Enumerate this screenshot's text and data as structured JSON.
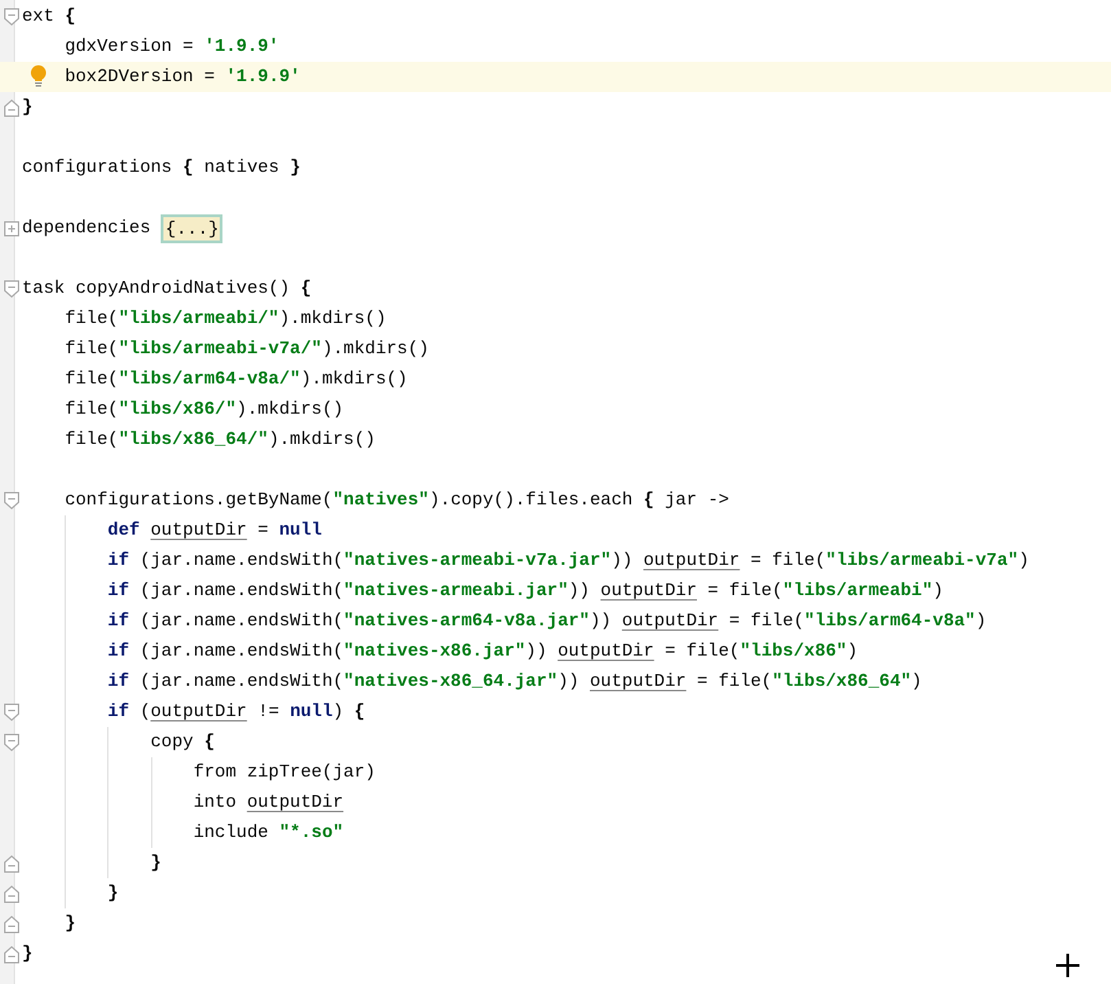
{
  "editor": {
    "lines": [
      {
        "kind": "code",
        "fold": {
          "kind": "start"
        },
        "highlighted": false,
        "bulb": false,
        "tokens": [
          {
            "kind": "plain",
            "text": "ext "
          },
          {
            "kind": "brace",
            "text": "{"
          }
        ]
      },
      {
        "kind": "code",
        "highlighted": false,
        "bulb": false,
        "tokens": [
          {
            "kind": "plain",
            "text": "    gdxVersion = "
          },
          {
            "kind": "string",
            "text": "'1.9.9'"
          }
        ]
      },
      {
        "kind": "code",
        "highlighted": true,
        "bulb": true,
        "tokens": [
          {
            "kind": "plain",
            "text": "    box2DVersion = "
          },
          {
            "kind": "string",
            "text": "'1.9.9'"
          }
        ]
      },
      {
        "kind": "code",
        "fold": {
          "kind": "end"
        },
        "highlighted": false,
        "bulb": false,
        "tokens": [
          {
            "kind": "brace",
            "text": "}"
          }
        ]
      },
      {
        "kind": "blank",
        "highlighted": false,
        "bulb": false
      },
      {
        "kind": "code",
        "highlighted": false,
        "bulb": false,
        "tokens": [
          {
            "kind": "plain",
            "text": "configurations "
          },
          {
            "kind": "brace",
            "text": "{"
          },
          {
            "kind": "plain",
            "text": " natives "
          },
          {
            "kind": "brace",
            "text": "}"
          }
        ]
      },
      {
        "kind": "blank",
        "highlighted": false,
        "bulb": false
      },
      {
        "kind": "code",
        "fold": {
          "kind": "collapsed"
        },
        "highlighted": false,
        "bulb": false,
        "tokens": [
          {
            "kind": "plain",
            "text": "dependencies "
          },
          {
            "kind": "folded",
            "text": "{...}"
          }
        ]
      },
      {
        "kind": "blank",
        "highlighted": false,
        "bulb": false
      },
      {
        "kind": "code",
        "fold": {
          "kind": "start"
        },
        "highlighted": false,
        "bulb": false,
        "tokens": [
          {
            "kind": "plain",
            "text": "task copyAndroidNatives() "
          },
          {
            "kind": "brace",
            "text": "{"
          }
        ]
      },
      {
        "kind": "code",
        "highlighted": false,
        "bulb": false,
        "tokens": [
          {
            "kind": "plain",
            "text": "    file("
          },
          {
            "kind": "string",
            "text": "\"libs/armeabi/\""
          },
          {
            "kind": "plain",
            "text": ").mkdirs()"
          }
        ]
      },
      {
        "kind": "code",
        "highlighted": false,
        "bulb": false,
        "tokens": [
          {
            "kind": "plain",
            "text": "    file("
          },
          {
            "kind": "string",
            "text": "\"libs/armeabi-v7a/\""
          },
          {
            "kind": "plain",
            "text": ").mkdirs()"
          }
        ]
      },
      {
        "kind": "code",
        "highlighted": false,
        "bulb": false,
        "tokens": [
          {
            "kind": "plain",
            "text": "    file("
          },
          {
            "kind": "string",
            "text": "\"libs/arm64-v8a/\""
          },
          {
            "kind": "plain",
            "text": ").mkdirs()"
          }
        ]
      },
      {
        "kind": "code",
        "highlighted": false,
        "bulb": false,
        "tokens": [
          {
            "kind": "plain",
            "text": "    file("
          },
          {
            "kind": "string",
            "text": "\"libs/x86/\""
          },
          {
            "kind": "plain",
            "text": ").mkdirs()"
          }
        ]
      },
      {
        "kind": "code",
        "highlighted": false,
        "bulb": false,
        "tokens": [
          {
            "kind": "plain",
            "text": "    file("
          },
          {
            "kind": "string",
            "text": "\"libs/x86_64/\""
          },
          {
            "kind": "plain",
            "text": ").mkdirs()"
          }
        ]
      },
      {
        "kind": "blank",
        "highlighted": false,
        "bulb": false
      },
      {
        "kind": "code",
        "fold": {
          "kind": "start"
        },
        "highlighted": false,
        "bulb": false,
        "tokens": [
          {
            "kind": "plain",
            "text": "    configurations.getByName("
          },
          {
            "kind": "string",
            "text": "\"natives\""
          },
          {
            "kind": "plain",
            "text": ").copy().files.each "
          },
          {
            "kind": "brace",
            "text": "{"
          },
          {
            "kind": "plain",
            "text": " jar ->"
          }
        ]
      },
      {
        "kind": "code",
        "highlighted": false,
        "bulb": false,
        "tokens": [
          {
            "kind": "keyword",
            "text": "        def "
          },
          {
            "kind": "field",
            "text": "outputDir"
          },
          {
            "kind": "plain",
            "text": " = "
          },
          {
            "kind": "keyword",
            "text": "null"
          }
        ]
      },
      {
        "kind": "code",
        "highlighted": false,
        "bulb": false,
        "tokens": [
          {
            "kind": "keyword",
            "text": "        if"
          },
          {
            "kind": "plain",
            "text": " (jar.name.endsWith("
          },
          {
            "kind": "string",
            "text": "\"natives-armeabi-v7a.jar\""
          },
          {
            "kind": "plain",
            "text": ")) "
          },
          {
            "kind": "field",
            "text": "outputDir"
          },
          {
            "kind": "plain",
            "text": " = file("
          },
          {
            "kind": "string",
            "text": "\"libs/armeabi-v7a\""
          },
          {
            "kind": "plain",
            "text": ")"
          }
        ]
      },
      {
        "kind": "code",
        "highlighted": false,
        "bulb": false,
        "tokens": [
          {
            "kind": "keyword",
            "text": "        if"
          },
          {
            "kind": "plain",
            "text": " (jar.name.endsWith("
          },
          {
            "kind": "string",
            "text": "\"natives-armeabi.jar\""
          },
          {
            "kind": "plain",
            "text": ")) "
          },
          {
            "kind": "field",
            "text": "outputDir"
          },
          {
            "kind": "plain",
            "text": " = file("
          },
          {
            "kind": "string",
            "text": "\"libs/armeabi\""
          },
          {
            "kind": "plain",
            "text": ")"
          }
        ]
      },
      {
        "kind": "code",
        "highlighted": false,
        "bulb": false,
        "tokens": [
          {
            "kind": "keyword",
            "text": "        if"
          },
          {
            "kind": "plain",
            "text": " (jar.name.endsWith("
          },
          {
            "kind": "string",
            "text": "\"natives-arm64-v8a.jar\""
          },
          {
            "kind": "plain",
            "text": ")) "
          },
          {
            "kind": "field",
            "text": "outputDir"
          },
          {
            "kind": "plain",
            "text": " = file("
          },
          {
            "kind": "string",
            "text": "\"libs/arm64-v8a\""
          },
          {
            "kind": "plain",
            "text": ")"
          }
        ]
      },
      {
        "kind": "code",
        "highlighted": false,
        "bulb": false,
        "tokens": [
          {
            "kind": "keyword",
            "text": "        if"
          },
          {
            "kind": "plain",
            "text": " (jar.name.endsWith("
          },
          {
            "kind": "string",
            "text": "\"natives-x86.jar\""
          },
          {
            "kind": "plain",
            "text": ")) "
          },
          {
            "kind": "field",
            "text": "outputDir"
          },
          {
            "kind": "plain",
            "text": " = file("
          },
          {
            "kind": "string",
            "text": "\"libs/x86\""
          },
          {
            "kind": "plain",
            "text": ")"
          }
        ]
      },
      {
        "kind": "code",
        "highlighted": false,
        "bulb": false,
        "tokens": [
          {
            "kind": "keyword",
            "text": "        if"
          },
          {
            "kind": "plain",
            "text": " (jar.name.endsWith("
          },
          {
            "kind": "string",
            "text": "\"natives-x86_64.jar\""
          },
          {
            "kind": "plain",
            "text": ")) "
          },
          {
            "kind": "field",
            "text": "outputDir"
          },
          {
            "kind": "plain",
            "text": " = file("
          },
          {
            "kind": "string",
            "text": "\"libs/x86_64\""
          },
          {
            "kind": "plain",
            "text": ")"
          }
        ]
      },
      {
        "kind": "code",
        "fold": {
          "kind": "start"
        },
        "highlighted": false,
        "bulb": false,
        "tokens": [
          {
            "kind": "keyword",
            "text": "        if"
          },
          {
            "kind": "plain",
            "text": " ("
          },
          {
            "kind": "field",
            "text": "outputDir"
          },
          {
            "kind": "plain",
            "text": " != "
          },
          {
            "kind": "keyword",
            "text": "null"
          },
          {
            "kind": "plain",
            "text": ") "
          },
          {
            "kind": "brace",
            "text": "{"
          }
        ]
      },
      {
        "kind": "code",
        "fold": {
          "kind": "start"
        },
        "highlighted": false,
        "bulb": false,
        "tokens": [
          {
            "kind": "plain",
            "text": "            copy "
          },
          {
            "kind": "brace",
            "text": "{"
          }
        ]
      },
      {
        "kind": "code",
        "highlighted": false,
        "bulb": false,
        "tokens": [
          {
            "kind": "plain",
            "text": "                from zipTree(jar)"
          }
        ]
      },
      {
        "kind": "code",
        "highlighted": false,
        "bulb": false,
        "tokens": [
          {
            "kind": "plain",
            "text": "                into "
          },
          {
            "kind": "field",
            "text": "outputDir"
          }
        ]
      },
      {
        "kind": "code",
        "highlighted": false,
        "bulb": false,
        "tokens": [
          {
            "kind": "plain",
            "text": "                include "
          },
          {
            "kind": "string",
            "text": "\"*.so\""
          }
        ]
      },
      {
        "kind": "code",
        "fold": {
          "kind": "end"
        },
        "highlighted": false,
        "bulb": false,
        "tokens": [
          {
            "kind": "brace",
            "text": "            }"
          }
        ]
      },
      {
        "kind": "code",
        "fold": {
          "kind": "end"
        },
        "highlighted": false,
        "bulb": false,
        "tokens": [
          {
            "kind": "brace",
            "text": "        }"
          }
        ]
      },
      {
        "kind": "code",
        "fold": {
          "kind": "end"
        },
        "highlighted": false,
        "bulb": false,
        "tokens": [
          {
            "kind": "brace",
            "text": "    }"
          }
        ]
      },
      {
        "kind": "code",
        "fold": {
          "kind": "end"
        },
        "highlighted": false,
        "bulb": false,
        "tokens": [
          {
            "kind": "brace",
            "text": "}"
          }
        ]
      }
    ]
  }
}
